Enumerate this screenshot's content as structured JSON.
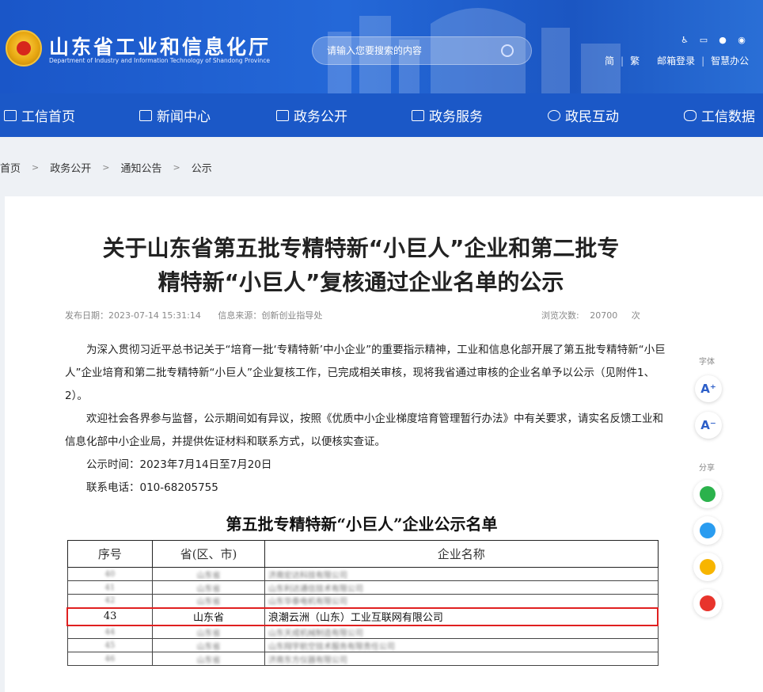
{
  "header": {
    "site_title": "山东省工业和信息化厅",
    "site_subtitle": "Department of Industry and Information Technology of Shandong Province",
    "search_placeholder": "请输入您要搜索的内容",
    "top_icons": [
      "accessibility-icon",
      "mobile-icon",
      "wechat-icon",
      "weibo-icon"
    ],
    "links": {
      "simplified": "简",
      "traditional": "繁",
      "mail": "邮箱登录",
      "office": "智慧办公"
    }
  },
  "nav": {
    "items": [
      {
        "label": "工信首页",
        "icon": "home-icon"
      },
      {
        "label": "新闻中心",
        "icon": "news-icon"
      },
      {
        "label": "政务公开",
        "icon": "monitor-icon"
      },
      {
        "label": "政务服务",
        "icon": "service-icon"
      },
      {
        "label": "政民互动",
        "icon": "chat-icon"
      },
      {
        "label": "工信数据",
        "icon": "database-icon"
      }
    ]
  },
  "breadcrumb": {
    "items": [
      "首页",
      "政务公开",
      "通知公告",
      "公示"
    ],
    "separator": ">"
  },
  "article": {
    "title_line1": "关于山东省第五批专精特新“小巨人”企业和第二批专",
    "title_line2": "精特新“小巨人”复核通过企业名单的公示",
    "publish_date": "发布日期：2023-07-14 15:31:14",
    "source": "信息来源：创新创业指导处",
    "views_label": "浏览次数:",
    "views_count": "20700",
    "views_unit": "次",
    "paragraphs": [
      "为深入贯彻习近平总书记关于“培育一批‘专精特新’中小企业”的重要指示精神，工业和信息化部开展了第五批专精特新“小巨人”企业培育和第二批专精特新“小巨人”企业复核工作，已完成相关审核，现将我省通过审核的企业名单予以公示（见附件1、2）。",
      "欢迎社会各界参与监督，公示期间如有异议，按照《优质中小企业梯度培育管理暂行办法》中有关要求，请实名反馈工业和信息化部中小企业局，并提供佐证材料和联系方式，以便核实查证。",
      "公示时间：2023年7月14日至7月20日",
      "联系电话：010-68205755"
    ]
  },
  "side": {
    "font_label": "字体",
    "font_increase": "A⁺",
    "font_decrease": "A⁻",
    "share_label": "分享"
  },
  "list": {
    "title": "第五批专精特新“小巨人”企业公示名单",
    "headers": [
      "序号",
      "省(区、市)",
      "企业名称"
    ],
    "rows_before": [
      {
        "no": "40",
        "province": "山东省",
        "name": "济南宏达科技有限公司"
      },
      {
        "no": "41",
        "province": "山东省",
        "name": "山东利达通信技术有限公司"
      },
      {
        "no": "42",
        "province": "山东省",
        "name": "山东华泰电机有限公司"
      }
    ],
    "highlight_row": {
      "no": "43",
      "province": "山东省",
      "name": "浪潮云洲（山东）工业互联网有限公司"
    },
    "rows_after": [
      {
        "no": "44",
        "province": "山东省",
        "name": "山东天成机械制造有限公司"
      },
      {
        "no": "45",
        "province": "山东省",
        "name": "山东翔宇航空技术服务有限责任公司"
      },
      {
        "no": "46",
        "province": "山东省",
        "name": "济南东方仪器有限公司"
      }
    ]
  },
  "colors": {
    "brand_blue": "#1b58c7",
    "highlight_red": "#e02020"
  }
}
